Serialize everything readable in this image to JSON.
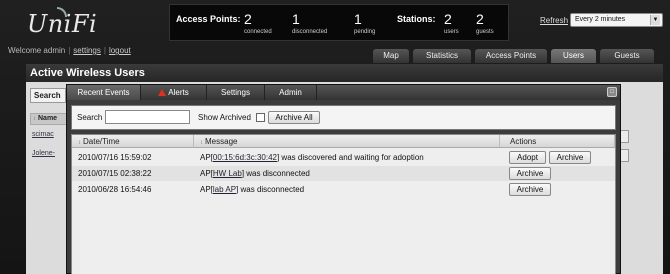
{
  "app": {
    "logo": "UniFi"
  },
  "user_bar": {
    "welcome": "Welcome admin",
    "settings": "settings",
    "logout": "logout"
  },
  "stats": {
    "access_points_label": "Access Points:",
    "ap_connected": "2",
    "ap_connected_label": "connected",
    "ap_disconnected": "1",
    "ap_disconnected_label": "disconnected",
    "ap_pending": "1",
    "ap_pending_label": "pending",
    "stations_label": "Stations:",
    "st_users": "2",
    "st_users_label": "users",
    "st_guests": "2",
    "st_guests_label": "guests"
  },
  "refresh": {
    "label": "Refresh",
    "selected": "Every 2 minutes"
  },
  "main_tabs": [
    "Map",
    "Statistics",
    "Access Points",
    "Users",
    "Guests"
  ],
  "panel": {
    "title": "Active Wireless Users",
    "search_tab": "Search",
    "name_col": "Name",
    "users": [
      "scimac",
      "Jolene-"
    ]
  },
  "dialog": {
    "tabs": [
      "Recent Events",
      "Alerts",
      "Settings",
      "Admin"
    ],
    "close_glyph": "□",
    "search_label": "Search",
    "search_value": "",
    "show_archived_label": "Show Archived",
    "archive_all_label": "Archive All",
    "columns": [
      "Date/Time",
      "Message",
      "Actions"
    ],
    "rows": [
      {
        "datetime": "2010/07/16  15:59:02",
        "pre": "AP[",
        "link": "00:15:6d:3c:30:42",
        "post": "] was discovered and waiting for adoption",
        "adopt": "Adopt",
        "archive": "Archive"
      },
      {
        "datetime": "2010/07/15  02:38:22",
        "pre": "AP[",
        "link": "HW Lab",
        "post": "] was disconnected",
        "archive": "Archive"
      },
      {
        "datetime": "2010/06/28  16:54:46",
        "pre": "AP[",
        "link": "lab AP",
        "post": "] was disconnected",
        "archive": "Archive"
      }
    ]
  },
  "colors": {
    "alert": "#e03020",
    "bar": "#080808"
  }
}
